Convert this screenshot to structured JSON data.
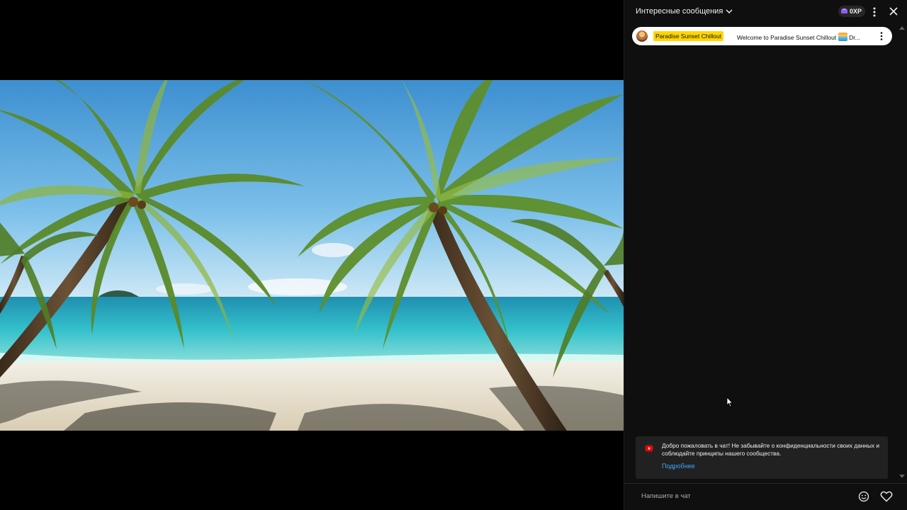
{
  "chat": {
    "title": "Интересные сообщения",
    "xp": "0XP",
    "pinned": {
      "author": "Paradise Sunset Chillout",
      "message_start": "Welcome to Paradise Sunset Chillout",
      "message_end": "Dr..."
    },
    "notice": {
      "text": "Добро пожаловать в чат! Не забывайте о конфиденциальности своих данных и соблюдайте принципы нашего сообщества.",
      "link": "Подробнее"
    },
    "input_placeholder": "Напишите в чат"
  },
  "icons": {
    "title_dropdown": "chevron-down-icon",
    "xp": "xp-gem-icon",
    "header_more": "more-vert-icon",
    "close": "close-icon",
    "pinned_more": "more-vert-icon",
    "notice": "youtube-icon",
    "emoji": "emoji-icon",
    "heart": "heart-icon"
  },
  "colors": {
    "chat_bg": "#0f0f0f",
    "author_highlight": "#ffd600",
    "link": "#3ea6ff",
    "youtube_red": "#ff0000"
  }
}
